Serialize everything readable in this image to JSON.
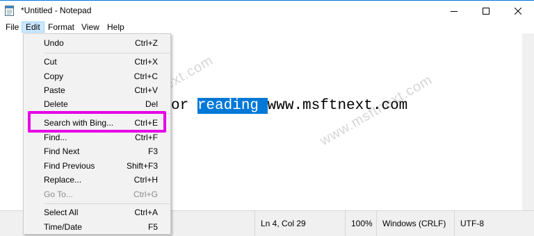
{
  "window": {
    "title": "*Untitled - Notepad"
  },
  "menubar": [
    "File",
    "Edit",
    "Format",
    "View",
    "Help"
  ],
  "editor": {
    "text_before": "or ",
    "text_selected": "reading ",
    "text_after": "www.msftnext.com"
  },
  "watermarks": [
    "www.msftnext.com",
    "www.msftnext.com"
  ],
  "edit_menu": {
    "items": [
      {
        "label": "Undo",
        "shortcut": "Ctrl+Z"
      },
      {
        "label": "Cut",
        "shortcut": "Ctrl+X"
      },
      {
        "label": "Copy",
        "shortcut": "Ctrl+C"
      },
      {
        "label": "Paste",
        "shortcut": "Ctrl+V"
      },
      {
        "label": "Delete",
        "shortcut": "Del"
      },
      {
        "label": "Search with Bing...",
        "shortcut": "Ctrl+E"
      },
      {
        "label": "Find...",
        "shortcut": "Ctrl+F"
      },
      {
        "label": "Find Next",
        "shortcut": "F3"
      },
      {
        "label": "Find Previous",
        "shortcut": "Shift+F3"
      },
      {
        "label": "Replace...",
        "shortcut": "Ctrl+H"
      },
      {
        "label": "Go To...",
        "shortcut": "Ctrl+G",
        "disabled": true
      },
      {
        "label": "Select All",
        "shortcut": "Ctrl+A"
      },
      {
        "label": "Time/Date",
        "shortcut": "F5"
      }
    ]
  },
  "statusbar": {
    "position": "Ln 4, Col 29",
    "zoom": "100%",
    "line_ending": "Windows (CRLF)",
    "encoding": "UTF-8"
  },
  "colors": {
    "accent": "#0078d7",
    "highlight": "#e600e6",
    "menu_hover": "#cce8ff"
  }
}
